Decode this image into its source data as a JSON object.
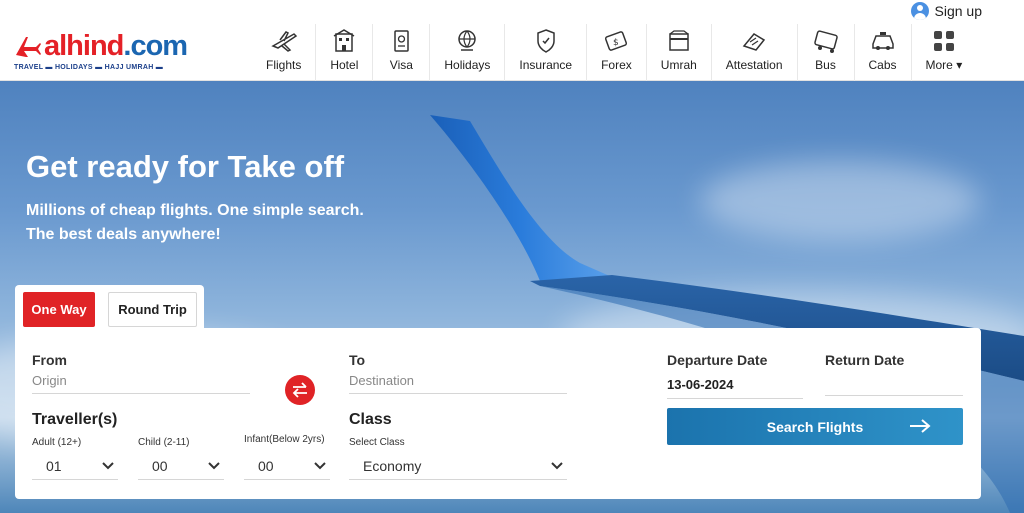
{
  "top": {
    "signup_label": "Sign up"
  },
  "logo": {
    "brand_al": "alhind",
    "brand_com": ".com",
    "tagline": "TRAVEL ▬ HOLIDAYS ▬ HAJJ UMRAH ▬"
  },
  "nav": {
    "items": [
      {
        "label": "Flights",
        "icon": "flight-icon"
      },
      {
        "label": "Hotel",
        "icon": "hotel-icon"
      },
      {
        "label": "Visa",
        "icon": "visa-icon"
      },
      {
        "label": "Holidays",
        "icon": "holidays-icon"
      },
      {
        "label": "Insurance",
        "icon": "insurance-icon"
      },
      {
        "label": "Forex",
        "icon": "forex-icon"
      },
      {
        "label": "Umrah",
        "icon": "umrah-icon"
      },
      {
        "label": "Attestation",
        "icon": "attestation-icon"
      },
      {
        "label": "Bus",
        "icon": "bus-icon"
      },
      {
        "label": "Cabs",
        "icon": "cab-icon"
      },
      {
        "label": "More",
        "icon": "grid-icon"
      }
    ]
  },
  "hero": {
    "title": "Get ready for Take off",
    "subtitle_line1": "Millions of cheap flights. One simple search.",
    "subtitle_line2": "The best deals anywhere!"
  },
  "tabs": {
    "oneway": "One Way",
    "roundtrip": "Round Trip"
  },
  "form": {
    "from_label": "From",
    "from_placeholder": "Origin",
    "to_label": "To",
    "to_placeholder": "Destination",
    "departure_label": "Departure Date",
    "departure_value": "13-06-2024",
    "return_label": "Return Date",
    "return_value": "",
    "travellers_label": "Traveller(s)",
    "adult_label": "Adult (12+)",
    "adult_value": "01",
    "child_label": "Child (2-11)",
    "child_value": "00",
    "infant_label": "Infant(Below 2yrs)",
    "infant_value": "00",
    "class_label": "Class",
    "select_class_label": "Select Class",
    "class_value": "Economy",
    "search_button": "Search Flights"
  },
  "colors": {
    "brand_red": "#e02326",
    "brand_blue": "#1b66b1",
    "button_blue": "#1b73ad"
  }
}
